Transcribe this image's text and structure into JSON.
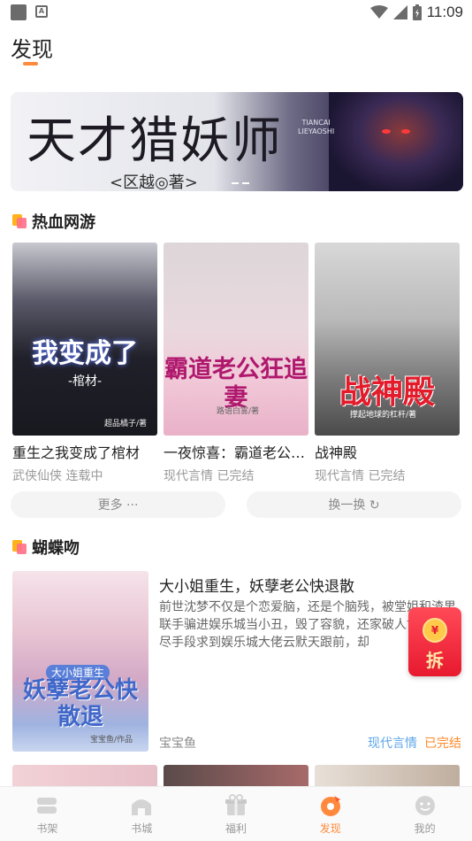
{
  "status_bar": {
    "time": "11:09",
    "notif_badge": "A"
  },
  "page": {
    "title": "发现"
  },
  "banner": {
    "title": "天才猎妖师",
    "author_line": "<区越◎著>",
    "subtitle_en_1": "TIANCAI",
    "subtitle_en_2": "LIEYAOSHI"
  },
  "section_hot": {
    "title": "热血网游",
    "books": [
      {
        "name": "重生之我变成了棺材",
        "meta": "武侠仙侠 连载中",
        "cover_title": "我变成了",
        "cover_sub": "-棺材-",
        "cover_author": "超品橘子/著"
      },
      {
        "name": "一夜惊喜：霸道老公狂追妻",
        "meta": "现代言情 已完结",
        "cover_title": "霸道老公狂追妻",
        "cover_author": "路语白雾/著"
      },
      {
        "name": "战神殿",
        "meta": "现代言情 已完结",
        "cover_title": "战神殿",
        "cover_author": "撑起地球的杠杆/著"
      }
    ],
    "more_label": "更多 ···",
    "swap_label": "换一换 ↻"
  },
  "section_butterfly": {
    "title": "蝴蝶吻",
    "featured": {
      "title": "大小姐重生，妖孽老公快退散",
      "description": "前世沈梦不仅是个恋爱脑，还是个脑残，被堂姐和渣男联手骗进娱乐城当小丑，毁了容貌，还家破人亡。她用尽手段求到娱乐城大佬云默天跟前，却",
      "author": "宝宝鱼",
      "genre": "现代言情",
      "status": "已完结",
      "cover_tag": "大小姐重生",
      "cover_title": "妖孽老公快散退",
      "cover_author": "宝宝鱼/作品"
    }
  },
  "red_packet": {
    "coin_symbol": "¥",
    "label": "拆"
  },
  "tabbar": {
    "tabs": [
      {
        "label": "书架",
        "icon": "bookshelf-icon"
      },
      {
        "label": "书城",
        "icon": "bookstore-icon"
      },
      {
        "label": "福利",
        "icon": "gift-icon"
      },
      {
        "label": "发现",
        "icon": "discover-icon",
        "active": true
      },
      {
        "label": "我的",
        "icon": "profile-icon"
      }
    ]
  },
  "colors": {
    "accent": "#ff8a3d",
    "genre": "#5fa6ea",
    "status_done": "#ff8a2a",
    "red_packet": "#e8192f"
  }
}
